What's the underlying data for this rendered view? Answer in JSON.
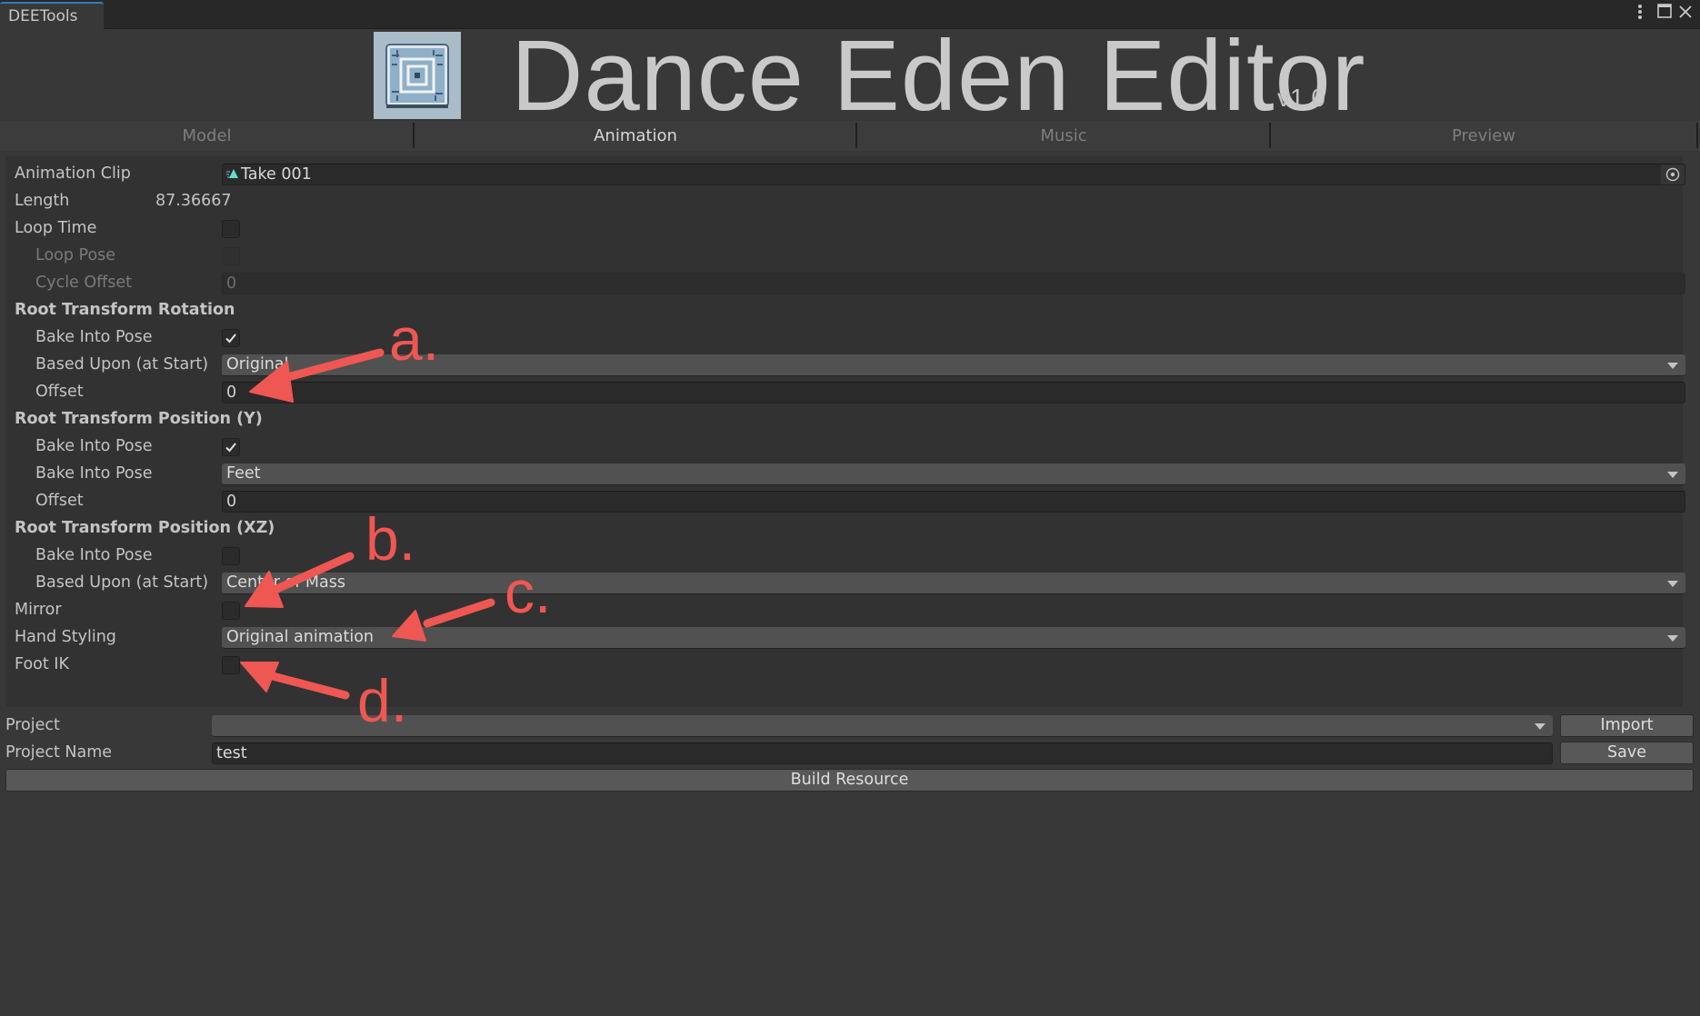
{
  "window": {
    "tab_title": "DEETools",
    "controls": {
      "menu_icon": "vertical-ellipsis-icon",
      "maximize_icon": "maximize-icon",
      "close_icon": "close-icon"
    }
  },
  "header": {
    "title": "Dance Eden Editor",
    "version": "v1.0",
    "logo_icon": "circuit-logo-icon"
  },
  "tabs": [
    {
      "label": "Model",
      "active": false
    },
    {
      "label": "Animation",
      "active": true
    },
    {
      "label": "Music",
      "active": false
    },
    {
      "label": "Preview",
      "active": false
    }
  ],
  "animation": {
    "clip": {
      "label": "Animation Clip",
      "value": "Take 001",
      "icon": "animation-clip-icon",
      "picker_icon": "object-picker-icon"
    },
    "length": {
      "label": "Length",
      "value": "87.36667"
    },
    "loop_time": {
      "label": "Loop Time",
      "checked": false
    },
    "loop_pose": {
      "label": "Loop Pose",
      "checked": false,
      "disabled": true
    },
    "cycle_offset": {
      "label": "Cycle Offset",
      "value": "0",
      "disabled": true
    },
    "root_rotation": {
      "header": "Root Transform Rotation",
      "bake": {
        "label": "Bake Into Pose",
        "checked": true
      },
      "based_upon": {
        "label": "Based Upon (at Start)",
        "value": "Original"
      },
      "offset": {
        "label": "Offset",
        "value": "0"
      }
    },
    "root_position_y": {
      "header": "Root Transform Position (Y)",
      "bake": {
        "label": "Bake Into Pose",
        "checked": true
      },
      "based_upon": {
        "label": "Bake Into Pose",
        "value": "Feet"
      },
      "offset": {
        "label": "Offset",
        "value": "0"
      }
    },
    "root_position_xz": {
      "header": "Root Transform Position (XZ)",
      "bake": {
        "label": "Bake Into Pose",
        "checked": false
      },
      "based_upon": {
        "label": "Based Upon (at Start)",
        "value": "Center of Mass"
      }
    },
    "mirror": {
      "label": "Mirror",
      "checked": false
    },
    "hand_styling": {
      "label": "Hand Styling",
      "value": "Original animation"
    },
    "foot_ik": {
      "label": "Foot IK",
      "checked": false
    }
  },
  "project": {
    "project_label": "Project",
    "project_value": "",
    "import_label": "Import",
    "name_label": "Project Name",
    "name_value": "test",
    "save_label": "Save",
    "build_label": "Build Resource"
  },
  "annotations": [
    {
      "label": "a.",
      "target": "root-rotation-offset-field"
    },
    {
      "label": "b.",
      "target": "mirror-checkbox"
    },
    {
      "label": "c.",
      "target": "hand-styling-dropdown"
    },
    {
      "label": "d.",
      "target": "foot-ik-checkbox"
    }
  ],
  "colors": {
    "annotation": "#ef5753",
    "active_tab_underline": "#3a79bb",
    "clip_icon": "#5fe0d0"
  }
}
